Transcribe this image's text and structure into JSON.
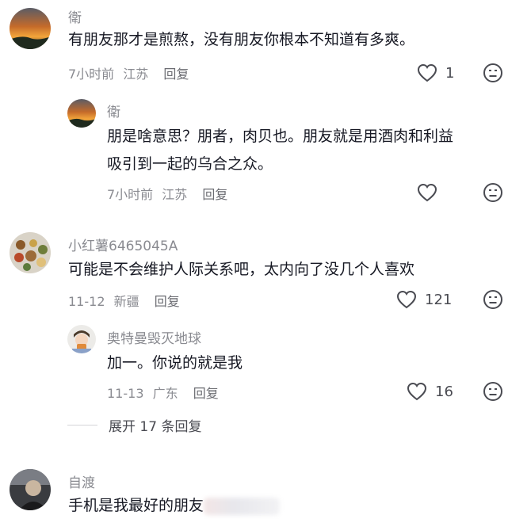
{
  "comments": [
    {
      "author": "衛",
      "text": "有朋友那才是煎熬，没有朋友你根本不知道有多爽。",
      "time": "7小时前",
      "location": "江苏",
      "reply_label": "回复",
      "likes": "1",
      "replies": [
        {
          "author": "衛",
          "text_line1": "朋是啥意思？朋者，肉贝也。朋友就是用酒肉和利益",
          "text_line2": "吸引到一起的乌合之众。",
          "time": "7小时前",
          "location": "江苏",
          "reply_label": "回复",
          "likes": ""
        }
      ]
    },
    {
      "author": "小红薯6465045A",
      "text": "可能是不会维护人际关系吧，太内向了没几个人喜欢",
      "time": "11-12",
      "location": "新疆",
      "reply_label": "回复",
      "likes": "121",
      "replies": [
        {
          "author": "奥特曼毁灭地球",
          "text": "加一。你说的就是我",
          "time": "11-13",
          "location": "广东",
          "reply_label": "回复",
          "likes": "16"
        }
      ],
      "expand_label": "展开 17 条回复"
    },
    {
      "author": "自渡",
      "text": "手机是我最好的朋友"
    }
  ],
  "colors": {
    "meta": "#8a8b91",
    "text": "#161823"
  },
  "icons": {
    "like": "heart-outline-icon",
    "dislike": "dislike-face-icon"
  }
}
